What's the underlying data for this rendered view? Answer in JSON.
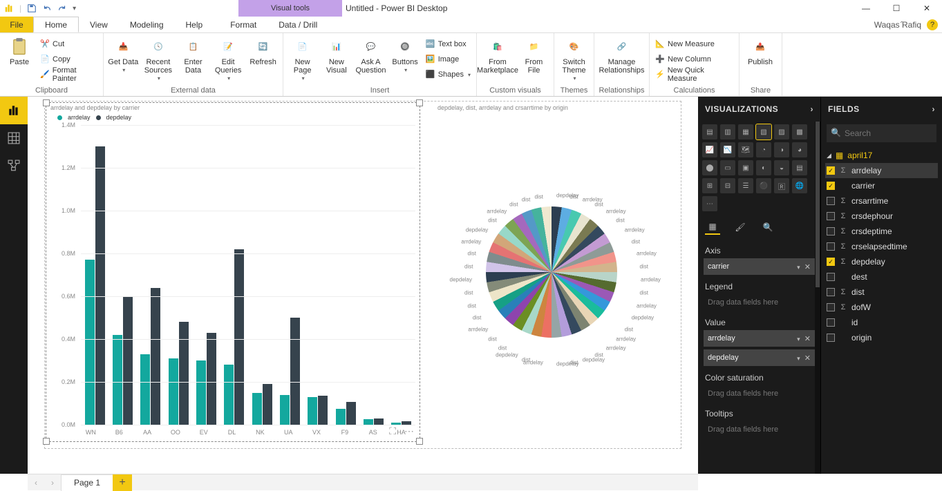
{
  "app": {
    "title": "Untitled - Power BI Desktop",
    "visual_tools": "Visual tools",
    "user": "Waqas Rafiq"
  },
  "tabs": [
    "Home",
    "View",
    "Modeling",
    "Help",
    "Format",
    "Data / Drill"
  ],
  "file_label": "File",
  "ribbon": {
    "clipboard": {
      "paste": "Paste",
      "cut": "Cut",
      "copy": "Copy",
      "format_painter": "Format Painter",
      "label": "Clipboard"
    },
    "external": {
      "get_data": "Get Data",
      "recent_sources": "Recent Sources",
      "enter_data": "Enter Data",
      "edit_queries": "Edit Queries",
      "refresh": "Refresh",
      "label": "External data"
    },
    "insert": {
      "new_page": "New Page",
      "new_visual": "New Visual",
      "ask": "Ask A Question",
      "buttons": "Buttons",
      "text_box": "Text box",
      "image": "Image",
      "shapes": "Shapes",
      "from_marketplace": "From Marketplace",
      "from_file": "From File",
      "label": "Insert"
    },
    "custom": {
      "label": "Custom visuals"
    },
    "themes": {
      "switch_theme": "Switch Theme",
      "label": "Themes"
    },
    "relationships": {
      "manage": "Manage Relationships",
      "label": "Relationships"
    },
    "calculations": {
      "new_measure": "New Measure",
      "new_column": "New Column",
      "new_quick": "New Quick Measure",
      "label": "Calculations"
    },
    "share": {
      "publish": "Publish",
      "label": "Share"
    }
  },
  "canvas": {
    "bar_title": "arrdelay and depdelay by carrier",
    "pie_title": "depdelay, dist, arrdelay and crsarrtime by origin",
    "legend": {
      "s1": "arrdelay",
      "s2": "depdelay"
    },
    "y_ticks": [
      "1.4M",
      "1.2M",
      "1.0M",
      "0.8M",
      "0.6M",
      "0.4M",
      "0.2M",
      "0.0M"
    ],
    "pie_labels": [
      "depdelay",
      "dist",
      "arrdelay",
      "dist",
      "arrdelay",
      "dist",
      "arrdelay",
      "dist",
      "arrdelay",
      "dist",
      "arrdelay",
      "dist",
      "arrdelay",
      "depdelay",
      "dist",
      "arrdelay",
      "arrdelay",
      "dist",
      "depdelay",
      "dist",
      "depdelay",
      "arrdelay",
      "dist",
      "depdelay",
      "dist",
      "dist",
      "arrdelay",
      "dist",
      "dist",
      "dist",
      "depdelay",
      "dist",
      "dist",
      "arrdelay",
      "depdelay",
      "dist",
      "arrdelay",
      "dist",
      "dist",
      "dist"
    ]
  },
  "chart_data": {
    "type": "bar",
    "title": "arrdelay and depdelay by carrier",
    "xlabel": "carrier",
    "ylabel": "",
    "ylim": [
      0,
      1400000
    ],
    "categories": [
      "WN",
      "B6",
      "AA",
      "OO",
      "EV",
      "DL",
      "NK",
      "UA",
      "VX",
      "F9",
      "AS",
      "HA"
    ],
    "series": [
      {
        "name": "arrdelay",
        "values": [
          770000,
          420000,
          330000,
          310000,
          300000,
          280000,
          150000,
          140000,
          130000,
          75000,
          25000,
          10000
        ]
      },
      {
        "name": "depdelay",
        "values": [
          1300000,
          600000,
          640000,
          480000,
          430000,
          820000,
          190000,
          500000,
          135000,
          105000,
          30000,
          15000
        ]
      }
    ]
  },
  "viz_pane": {
    "title": "VISUALIZATIONS",
    "wells": {
      "axis": "Axis",
      "axis_field": "carrier",
      "legend": "Legend",
      "value": "Value",
      "v1": "arrdelay",
      "v2": "depdelay",
      "color_sat": "Color saturation",
      "tooltips": "Tooltips",
      "placeholder": "Drag data fields here"
    }
  },
  "fields_pane": {
    "title": "FIELDS",
    "search_placeholder": "Search",
    "table": "april17",
    "fields": [
      {
        "name": "arrdelay",
        "sigma": true,
        "checked": true
      },
      {
        "name": "carrier",
        "sigma": false,
        "checked": true
      },
      {
        "name": "crsarrtime",
        "sigma": true,
        "checked": false
      },
      {
        "name": "crsdephour",
        "sigma": true,
        "checked": false
      },
      {
        "name": "crsdeptime",
        "sigma": true,
        "checked": false
      },
      {
        "name": "crselapsedtime",
        "sigma": true,
        "checked": false
      },
      {
        "name": "depdelay",
        "sigma": true,
        "checked": true
      },
      {
        "name": "dest",
        "sigma": false,
        "checked": false
      },
      {
        "name": "dist",
        "sigma": true,
        "checked": false
      },
      {
        "name": "dofW",
        "sigma": true,
        "checked": false
      },
      {
        "name": "id",
        "sigma": false,
        "checked": false
      },
      {
        "name": "origin",
        "sigma": false,
        "checked": false
      }
    ]
  },
  "pagetab": "Page 1"
}
